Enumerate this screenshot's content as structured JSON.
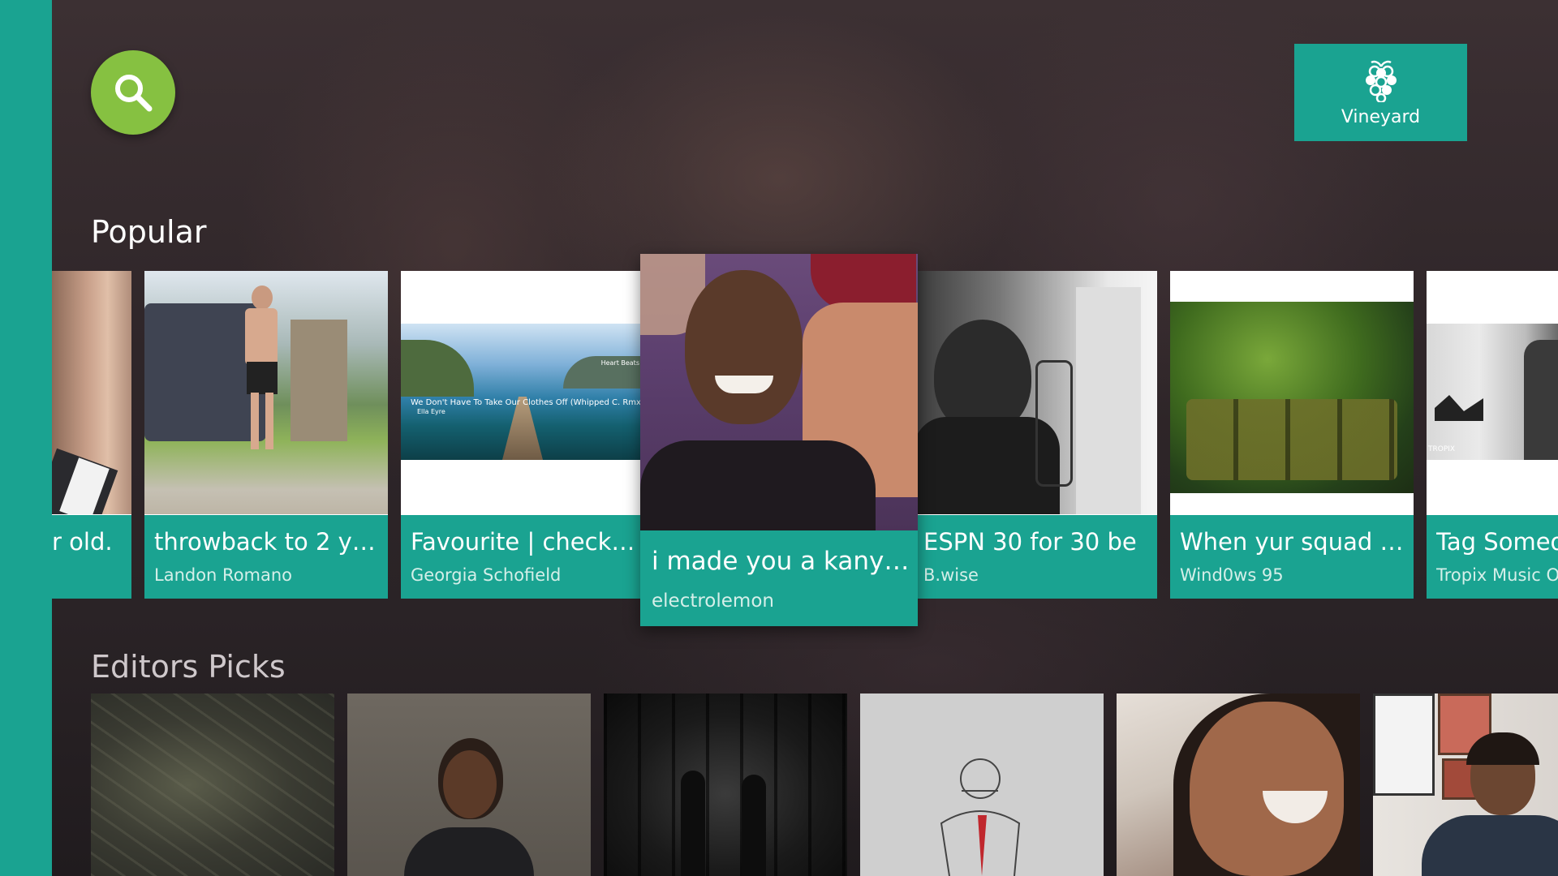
{
  "app": {
    "brand_name": "Vineyard",
    "accent_color": "#1aa391",
    "search_color": "#86c141",
    "search_icon": "search-icon",
    "brand_icon": "grape-logo-icon"
  },
  "popular": {
    "title": "Popular",
    "items": [
      {
        "title": "r old.",
        "author": ""
      },
      {
        "title": "throwback to 2 year...",
        "author": "Landon Romano"
      },
      {
        "title": "Favourite | check ou...",
        "author": "Georgia Schofield",
        "thumb_caption": "We Don't Have To Take Our Clothes Off (Whipped C. Rmx)",
        "thumb_subcaption": "Ella Eyre",
        "thumb_brand": "Heart Beats"
      },
      {
        "title": "i made you a kanye...",
        "author": "electrolemon"
      },
      {
        "title": "ESPN 30 for 30 be",
        "author": "B.wise"
      },
      {
        "title": "When yur squad af...",
        "author": "Wind0ws 95"
      },
      {
        "title": "Tag Someon",
        "author": "Tropix Music Of",
        "thumb_brand": "TROPIX"
      }
    ]
  },
  "editors_picks": {
    "title": "Editors Picks"
  }
}
